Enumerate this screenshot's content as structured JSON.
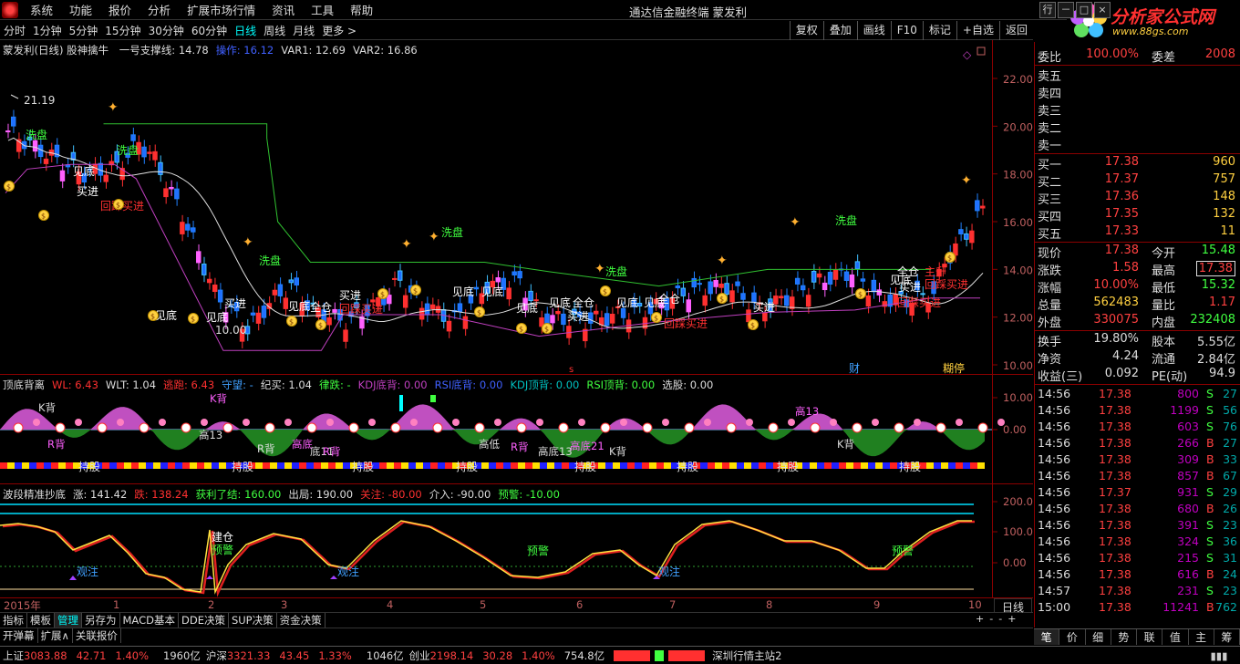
{
  "menu": [
    "系统",
    "功能",
    "报价",
    "分析",
    "扩展市场行情",
    "资讯",
    "工具",
    "帮助"
  ],
  "app_title": "通达信金融终端   蒙发利",
  "brand": {
    "name": "分析家公式网",
    "url": "www.88gs.com"
  },
  "periods": [
    "分时",
    "1分钟",
    "5分钟",
    "15分钟",
    "30分钟",
    "60分钟",
    "日线",
    "周线",
    "月线",
    "更多 >"
  ],
  "active_period": "日线",
  "toolbar_right": [
    "复权",
    "叠加",
    "画线",
    "F10",
    "标记",
    "+自选",
    "返回"
  ],
  "panel1": {
    "title": "蒙发利(日线) 股神擒牛",
    "legend": [
      {
        "text": "一号支撑线: 14.78",
        "color": "#ddd"
      },
      {
        "text": "操作: 16.12",
        "color": "#4060ff"
      },
      {
        "text": "VAR1: 12.69",
        "color": "#ddd"
      },
      {
        "text": "VAR2: 16.86",
        "color": "#ddd"
      }
    ],
    "price_labels": [
      "22.00",
      "20.00",
      "18.00",
      "16.00",
      "14.00",
      "12.00",
      "10.00"
    ],
    "high_label": "21.19",
    "low_label": "10.00",
    "annotations": [
      {
        "t": "洗盘",
        "c": "#40ff40"
      },
      {
        "t": "见底",
        "c": "#fff"
      },
      {
        "t": "买进",
        "c": "#fff"
      },
      {
        "t": "回踩买进",
        "c": "#ff3030"
      },
      {
        "t": "洗盘",
        "c": "#40ff40"
      },
      {
        "t": "见底",
        "c": "#fff"
      },
      {
        "t": "买进",
        "c": "#fff"
      },
      {
        "t": "洗盘",
        "c": "#40ff40"
      },
      {
        "t": "见底",
        "c": "#fff"
      },
      {
        "t": "见底",
        "c": "#fff"
      },
      {
        "t": "全仓",
        "c": "#fff"
      },
      {
        "t": "买进",
        "c": "#fff"
      },
      {
        "t": "回踩买进",
        "c": "#ff3030"
      },
      {
        "t": "洗盘",
        "c": "#40ff40"
      },
      {
        "t": "见底",
        "c": "#fff"
      },
      {
        "t": "见底",
        "c": "#fff"
      },
      {
        "t": "见底",
        "c": "#fff"
      },
      {
        "t": "见底",
        "c": "#fff"
      },
      {
        "t": "全仓",
        "c": "#fff"
      },
      {
        "t": "买进",
        "c": "#fff"
      },
      {
        "t": "洗盘",
        "c": "#40ff40"
      },
      {
        "t": "见底",
        "c": "#fff"
      },
      {
        "t": "见底",
        "c": "#fff"
      },
      {
        "t": "全仓",
        "c": "#fff"
      },
      {
        "t": "回踩买进",
        "c": "#ff3030"
      },
      {
        "t": "买进",
        "c": "#fff"
      },
      {
        "t": "洗盘",
        "c": "#40ff40"
      },
      {
        "t": "全仓",
        "c": "#fff"
      },
      {
        "t": "见底",
        "c": "#fff"
      },
      {
        "t": "买进",
        "c": "#fff"
      },
      {
        "t": "主升",
        "c": "#ff3030"
      },
      {
        "t": "回踩买进",
        "c": "#ff3030"
      },
      {
        "t": "回踩买进",
        "c": "#ff3030"
      }
    ],
    "footer_marks": [
      {
        "t": "财",
        "c": "#40a0ff"
      },
      {
        "t": "糊停",
        "c": "#ffd040"
      }
    ]
  },
  "panel2": {
    "title": "顶底背离",
    "legend": [
      {
        "text": "WL: 6.43",
        "color": "#ff3030"
      },
      {
        "text": "WLT: 1.04",
        "color": "#ddd"
      },
      {
        "text": "逃跑: 6.43",
        "color": "#ff3030"
      },
      {
        "text": "守望: -",
        "color": "#40a0ff"
      },
      {
        "text": "纪买: 1.04",
        "color": "#ddd"
      },
      {
        "text": "律跌: -",
        "color": "#40ff40"
      },
      {
        "text": "KDJ底背: 0.00",
        "color": "#c040c0"
      },
      {
        "text": "RSI底背: 0.00",
        "color": "#4060ff"
      },
      {
        "text": "KDJ顶背: 0.00",
        "color": "#00c0c0"
      },
      {
        "text": "RSI顶背: 0.00",
        "color": "#40ff40"
      },
      {
        "text": "选股: 0.00",
        "color": "#ddd"
      }
    ],
    "axis_labels": [
      "10.00",
      "0.00"
    ],
    "annotations": [
      "K背",
      "R背",
      "高13",
      "K背",
      "R背",
      "高底",
      "底11",
      "R背",
      "高低",
      "R背",
      "高底13",
      "高底21",
      "K背",
      "高13",
      "K背"
    ],
    "hold_labels": [
      "持股",
      "持股",
      "持股",
      "持股",
      "持股",
      "持股",
      "持股",
      "持股",
      "持股"
    ]
  },
  "panel3": {
    "title": "波段精准抄底",
    "legend": [
      {
        "text": "涨: 141.42",
        "color": "#ddd"
      },
      {
        "text": "跌: 138.24",
        "color": "#ff3030"
      },
      {
        "text": "获利了结: 160.00",
        "color": "#40ff40"
      },
      {
        "text": "出局: 190.00",
        "color": "#ddd"
      },
      {
        "text": "关注: -80.00",
        "color": "#ff3030"
      },
      {
        "text": "介入: -90.00",
        "color": "#ddd"
      },
      {
        "text": "预警: -10.00",
        "color": "#40ff40"
      }
    ],
    "axis_labels": [
      "200.0",
      "100.0",
      "0.00"
    ],
    "annotations": [
      {
        "t": "观注",
        "c": "#40a0ff"
      },
      {
        "t": "建仓",
        "c": "#fff"
      },
      {
        "t": "预警",
        "c": "#40ff40"
      },
      {
        "t": "观注",
        "c": "#40a0ff"
      },
      {
        "t": "预警",
        "c": "#40ff40"
      },
      {
        "t": "观注",
        "c": "#40a0ff"
      },
      {
        "t": "预警",
        "c": "#40ff40"
      }
    ]
  },
  "time_axis": [
    "2015年",
    "1",
    "2",
    "3",
    "4",
    "5",
    "6",
    "7",
    "8",
    "9",
    "10"
  ],
  "day_button": "日线",
  "bottom_tabs": [
    "指标",
    "模板",
    "管理",
    "另存为",
    "MACD基本",
    "DDE决策",
    "SUP决策",
    "资金决策"
  ],
  "active_bottom_tab": "管理",
  "bottom_bar": [
    "开弹幕",
    "扩展∧",
    "关联报价"
  ],
  "zoom_controls": [
    "+",
    "-",
    "-",
    "+"
  ],
  "quote": {
    "weibi_label": "委比",
    "weibi": "100.00%",
    "weicha_label": "委差",
    "weicha": "2008",
    "sell": [
      {
        "l": "卖五"
      },
      {
        "l": "卖四"
      },
      {
        "l": "卖三"
      },
      {
        "l": "卖二"
      },
      {
        "l": "卖一"
      }
    ],
    "buy": [
      {
        "l": "买一",
        "p": "17.38",
        "v": "960"
      },
      {
        "l": "买二",
        "p": "17.37",
        "v": "757"
      },
      {
        "l": "买三",
        "p": "17.36",
        "v": "148"
      },
      {
        "l": "买四",
        "p": "17.35",
        "v": "132"
      },
      {
        "l": "买五",
        "p": "17.33",
        "v": "11"
      }
    ],
    "stats": [
      {
        "l": "现价",
        "v": "17.38",
        "vc": "#ff4040",
        "l2": "今开",
        "v2": "15.48",
        "v2c": "#40ff40"
      },
      {
        "l": "涨跌",
        "v": "1.58",
        "vc": "#ff4040",
        "l2": "最高",
        "v2": "17.38",
        "v2c": "#ff4040",
        "box": true
      },
      {
        "l": "涨幅",
        "v": "10.00%",
        "vc": "#ff4040",
        "l2": "最低",
        "v2": "15.32",
        "v2c": "#40ff40"
      },
      {
        "l": "总量",
        "v": "562483",
        "vc": "#ffd040",
        "l2": "量比",
        "v2": "1.17",
        "v2c": "#ff4040"
      },
      {
        "l": "外盘",
        "v": "330075",
        "vc": "#ff4040",
        "l2": "内盘",
        "v2": "232408",
        "v2c": "#40ff40"
      }
    ],
    "stats2": [
      {
        "l": "换手",
        "v": "19.80%",
        "vc": "#ddd",
        "l2": "股本",
        "v2": "5.55亿",
        "v2c": "#ddd"
      },
      {
        "l": "净资",
        "v": "4.24",
        "vc": "#ddd",
        "l2": "流通",
        "v2": "2.84亿",
        "v2c": "#ddd"
      },
      {
        "l": "收益(三)",
        "v": "0.092",
        "vc": "#ddd",
        "l2": "PE(动)",
        "v2": "94.9",
        "v2c": "#ddd"
      }
    ],
    "ticks": [
      {
        "t": "14:56",
        "p": "17.38",
        "q": "800",
        "s": "S",
        "n": "27"
      },
      {
        "t": "14:56",
        "p": "17.38",
        "q": "1199",
        "s": "S",
        "n": "56"
      },
      {
        "t": "14:56",
        "p": "17.38",
        "q": "603",
        "s": "S",
        "n": "76"
      },
      {
        "t": "14:56",
        "p": "17.38",
        "q": "266",
        "s": "B",
        "n": "27"
      },
      {
        "t": "14:56",
        "p": "17.38",
        "q": "309",
        "s": "B",
        "n": "33"
      },
      {
        "t": "14:56",
        "p": "17.38",
        "q": "857",
        "s": "B",
        "n": "67"
      },
      {
        "t": "14:56",
        "p": "17.37",
        "q": "931",
        "s": "S",
        "n": "29"
      },
      {
        "t": "14:56",
        "p": "17.38",
        "q": "680",
        "s": "B",
        "n": "26"
      },
      {
        "t": "14:56",
        "p": "17.38",
        "q": "391",
        "s": "S",
        "n": "23"
      },
      {
        "t": "14:56",
        "p": "17.38",
        "q": "324",
        "s": "S",
        "n": "36"
      },
      {
        "t": "14:56",
        "p": "17.38",
        "q": "215",
        "s": "S",
        "n": "31"
      },
      {
        "t": "14:56",
        "p": "17.38",
        "q": "616",
        "s": "B",
        "n": "24"
      },
      {
        "t": "14:57",
        "p": "17.38",
        "q": "231",
        "s": "S",
        "n": "23"
      },
      {
        "t": "15:00",
        "p": "17.38",
        "q": "11241",
        "s": "B",
        "n": "762"
      }
    ],
    "tabs": [
      "笔",
      "价",
      "细",
      "势",
      "联",
      "值",
      "主",
      "筹"
    ],
    "active_tab": "笔"
  },
  "status": {
    "sh_label": "上证",
    "sh_val": "3083.88",
    "sh_chg": "42.71",
    "sh_pct": "1.40%",
    "sh_amt": "1960亿",
    "hs_label": "沪深",
    "hs_val": "3321.33",
    "hs_chg": "43.45",
    "hs_pct": "1.33%",
    "hs_amt": "1046亿",
    "cy_label": "创业",
    "cy_val": "2198.14",
    "cy_chg": "30.28",
    "cy_pct": "1.40%",
    "cy_amt": "754.8亿",
    "station": "深圳行情主站2"
  },
  "colors": {
    "up": "#ff4040",
    "down": "#40ff40",
    "axis": "#8b0000",
    "accent": "#00ffff"
  }
}
